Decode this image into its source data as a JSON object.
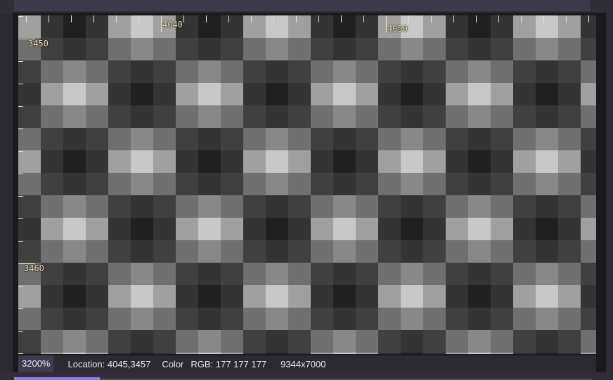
{
  "window": {
    "title": ""
  },
  "canvas": {
    "pattern_tile": [
      [
        [
          64,
          64,
          64
        ],
        [
          52,
          52,
          52
        ],
        [
          64,
          64,
          64
        ],
        [
          112,
          112,
          112
        ],
        [
          136,
          136,
          136
        ],
        [
          112,
          112,
          112
        ]
      ],
      [
        [
          52,
          52,
          52
        ],
        [
          32,
          32,
          32
        ],
        [
          52,
          52,
          52
        ],
        [
          160,
          160,
          160
        ],
        [
          200,
          200,
          200
        ],
        [
          160,
          160,
          160
        ]
      ],
      [
        [
          64,
          64,
          64
        ],
        [
          52,
          52,
          52
        ],
        [
          64,
          64,
          64
        ],
        [
          112,
          112,
          112
        ],
        [
          136,
          136,
          136
        ],
        [
          112,
          112,
          112
        ]
      ],
      [
        [
          112,
          112,
          112
        ],
        [
          136,
          136,
          136
        ],
        [
          112,
          112,
          112
        ],
        [
          64,
          64,
          64
        ],
        [
          52,
          52,
          52
        ],
        [
          64,
          64,
          64
        ]
      ],
      [
        [
          160,
          160,
          160
        ],
        [
          200,
          200,
          200
        ],
        [
          160,
          160,
          160
        ],
        [
          52,
          52,
          52
        ],
        [
          32,
          32,
          32
        ],
        [
          52,
          52,
          52
        ]
      ],
      [
        [
          112,
          112,
          112
        ],
        [
          136,
          136,
          136
        ],
        [
          112,
          112,
          112
        ],
        [
          64,
          64,
          64
        ],
        [
          52,
          52,
          52
        ],
        [
          64,
          64,
          64
        ]
      ]
    ],
    "pattern_offset": {
      "col": 2,
      "row": 4
    },
    "ruler": {
      "color": "#f0e2bd",
      "x_labels": [
        "4040",
        "4050"
      ],
      "y_labels": [
        "3450",
        "3460"
      ]
    }
  },
  "status": {
    "zoom": "3200%",
    "location": "Location: 4045,3457",
    "color_label": "Color",
    "rgb": "RGB: 177 177 177",
    "image_size": "9344x7000"
  }
}
